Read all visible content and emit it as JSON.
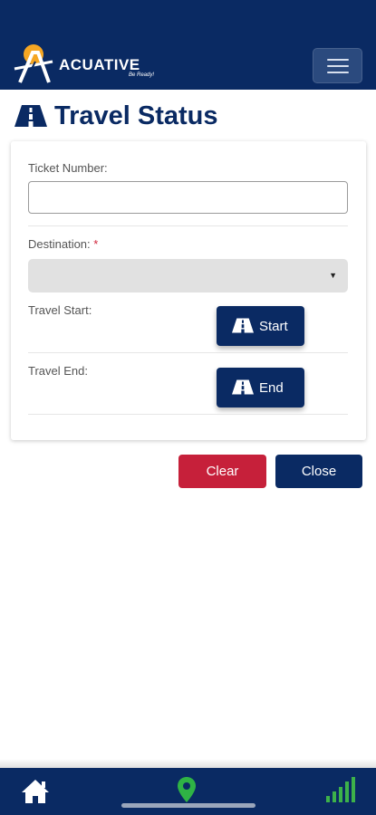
{
  "header": {
    "logo_name": "ACUATIVE",
    "logo_tagline": "Be Ready!",
    "menu_icon": "hamburger-menu-icon"
  },
  "page": {
    "title": "Travel Status",
    "title_icon": "road-icon"
  },
  "form": {
    "ticket_label": "Ticket Number:",
    "ticket_value": "",
    "destination_label": "Destination:",
    "destination_required": "*",
    "destination_value": "",
    "travel_start_label": "Travel Start:",
    "start_button": "Start",
    "travel_end_label": "Travel End:",
    "end_button": "End"
  },
  "actions": {
    "clear": "Clear",
    "close": "Close"
  },
  "bottom_nav": {
    "items": [
      "home-icon",
      "location-pin-icon",
      "signal-bars-icon"
    ]
  },
  "colors": {
    "brand_navy": "#0a2a63",
    "danger_red": "#c6203a",
    "location_green": "#2fb345",
    "signal_green": "#3db24a"
  }
}
